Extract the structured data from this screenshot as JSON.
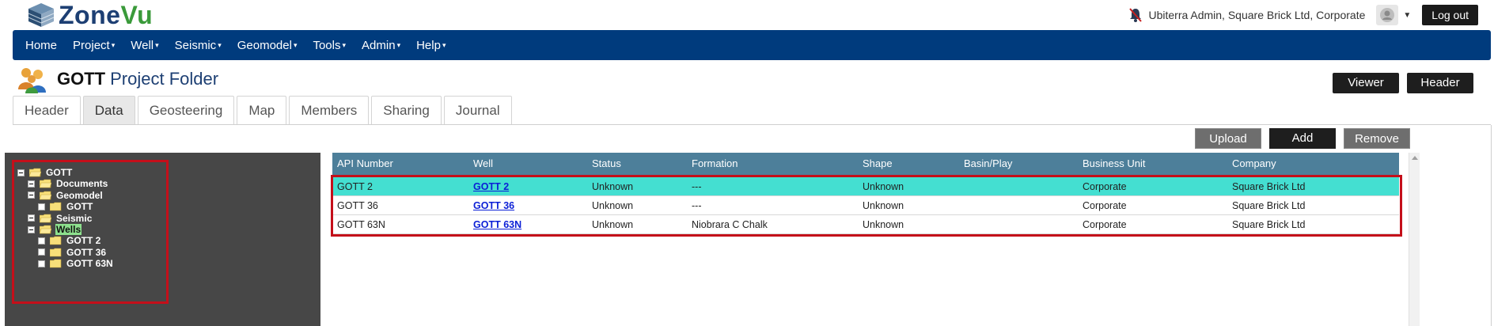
{
  "app": {
    "logo_text": "ZoneVu",
    "user_label": "Ubiterra Admin, Square Brick Ltd, Corporate",
    "logout_label": "Log out"
  },
  "nav": {
    "items": [
      {
        "label": "Home",
        "dropdown": false
      },
      {
        "label": "Project",
        "dropdown": true
      },
      {
        "label": "Well",
        "dropdown": true
      },
      {
        "label": "Seismic",
        "dropdown": true
      },
      {
        "label": "Geomodel",
        "dropdown": true
      },
      {
        "label": "Tools",
        "dropdown": true
      },
      {
        "label": "Admin",
        "dropdown": true
      },
      {
        "label": "Help",
        "dropdown": true
      }
    ]
  },
  "page": {
    "project_name": "GOTT",
    "subtitle": "Project Folder",
    "viewer_label": "Viewer",
    "header_label": "Header"
  },
  "tabs": [
    {
      "label": "Header",
      "active": false
    },
    {
      "label": "Data",
      "active": true
    },
    {
      "label": "Geosteering",
      "active": false
    },
    {
      "label": "Map",
      "active": false
    },
    {
      "label": "Members",
      "active": false
    },
    {
      "label": "Sharing",
      "active": false
    },
    {
      "label": "Journal",
      "active": false
    }
  ],
  "actions": {
    "upload": "Upload",
    "add": "Add",
    "remove": "Remove"
  },
  "tree": [
    {
      "label": "GOTT",
      "level": 0,
      "expanded": true,
      "selected": false
    },
    {
      "label": "Documents",
      "level": 1,
      "expanded": true,
      "selected": false
    },
    {
      "label": "Geomodel",
      "level": 1,
      "expanded": true,
      "selected": false
    },
    {
      "label": "GOTT",
      "level": 2,
      "expanded": false,
      "selected": false
    },
    {
      "label": "Seismic",
      "level": 1,
      "expanded": true,
      "selected": false
    },
    {
      "label": "Wells",
      "level": 1,
      "expanded": true,
      "selected": true
    },
    {
      "label": "GOTT 2",
      "level": 2,
      "expanded": false,
      "selected": false
    },
    {
      "label": "GOTT 36",
      "level": 2,
      "expanded": false,
      "selected": false
    },
    {
      "label": "GOTT 63N",
      "level": 2,
      "expanded": false,
      "selected": false
    }
  ],
  "grid": {
    "columns": [
      "API Number",
      "Well",
      "Status",
      "Formation",
      "Shape",
      "Basin/Play",
      "Business Unit",
      "Company"
    ],
    "rows": [
      {
        "api": "GOTT 2",
        "well": "GOTT 2",
        "status": "Unknown",
        "formation": "---",
        "shape": "Unknown",
        "basin": "",
        "unit": "Corporate",
        "company": "Square Brick Ltd",
        "highlighted": true
      },
      {
        "api": "GOTT 36",
        "well": "GOTT 36",
        "status": "Unknown",
        "formation": "---",
        "shape": "Unknown",
        "basin": "",
        "unit": "Corporate",
        "company": "Square Brick Ltd",
        "highlighted": false
      },
      {
        "api": "GOTT 63N",
        "well": "GOTT 63N",
        "status": "Unknown",
        "formation": "Niobrara C Chalk",
        "shape": "Unknown",
        "basin": "",
        "unit": "Corporate",
        "company": "Square Brick Ltd",
        "highlighted": false
      }
    ]
  },
  "colors": {
    "nav_bg": "#003b7d",
    "grid_header": "#4d7f9a",
    "row_highlight": "#44dfd1",
    "annotation_red": "#c40f1a",
    "tree_bg": "#474747"
  }
}
